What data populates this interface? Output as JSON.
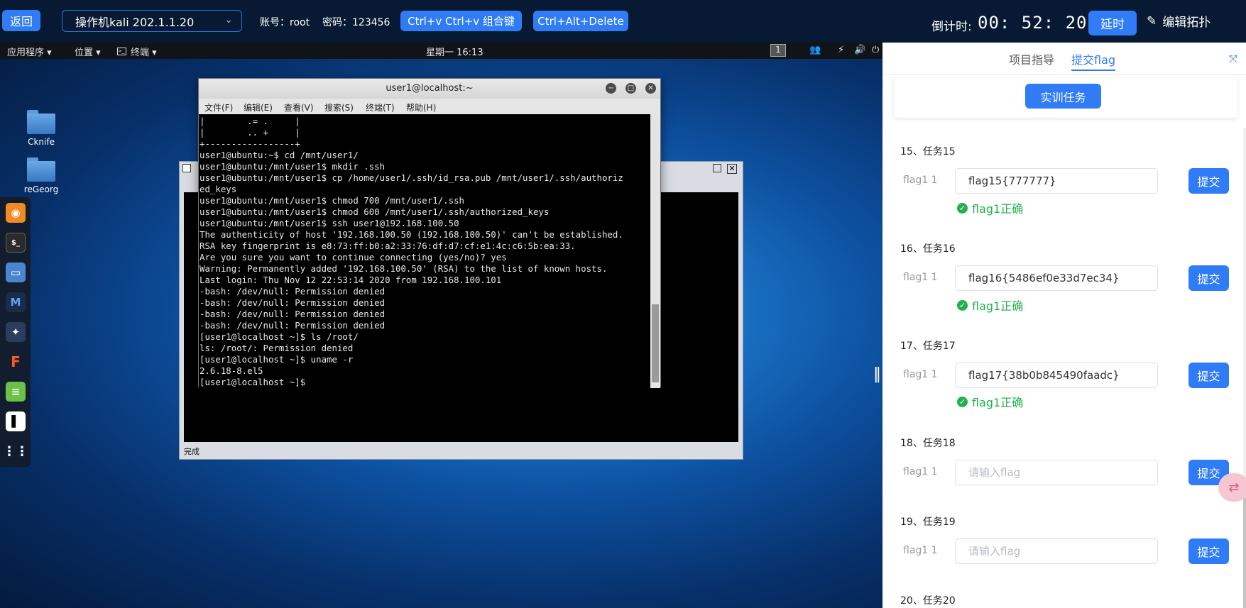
{
  "topbar": {
    "back_label": "返回",
    "host_label": "操作机kali 202.1.1.20",
    "account_label": "账号：root",
    "password_label": "密码：123456",
    "paste_combo_label": "Ctrl+v  Ctrl+v 组合键",
    "cad_label": "Ctrl+Alt+Delete",
    "countdown_label": "倒计时:",
    "countdown_value": "00:  52:  20",
    "extend_label": "延时",
    "edit_topology_label": "编辑拓扑"
  },
  "gnome": {
    "apps_label": "应用程序 ▾",
    "places_label": "位置 ▾",
    "terminal_label": "终端 ▾",
    "clock": "星期一 16:13",
    "workspace": "1"
  },
  "desktop_icons": [
    {
      "label": "Cknife"
    },
    {
      "label": "reGeorg"
    }
  ],
  "back_window": {
    "status": "完成"
  },
  "terminal": {
    "title": "user1@localhost:~",
    "menu": [
      "文件(F)",
      "编辑(E)",
      "查看(V)",
      "搜索(S)",
      "终端(T)",
      "帮助(H)"
    ],
    "lines": [
      "|        .= .     |",
      "|        .. +     |",
      "+-----------------+",
      "user1@ubuntu:~$ cd /mnt/user1/",
      "user1@ubuntu:/mnt/user1$ mkdir .ssh",
      "user1@ubuntu:/mnt/user1$ cp /home/user1/.ssh/id_rsa.pub /mnt/user1/.ssh/authoriz",
      "ed_keys",
      "user1@ubuntu:/mnt/user1$ chmod 700 /mnt/user1/.ssh",
      "user1@ubuntu:/mnt/user1$ chmod 600 /mnt/user1/.ssh/authorized_keys",
      "user1@ubuntu:/mnt/user1$ ssh user1@192.168.100.50",
      "The authenticity of host '192.168.100.50 (192.168.100.50)' can't be established.",
      "RSA key fingerprint is e8:73:ff:b0:a2:33:76:df:d7:cf:e1:4c:c6:5b:ea:33.",
      "Are you sure you want to continue connecting (yes/no)? yes",
      "Warning: Permanently added '192.168.100.50' (RSA) to the list of known hosts.",
      "Last login: Thu Nov 12 22:53:14 2020 from 192.168.100.101",
      "-bash: /dev/null: Permission denied",
      "-bash: /dev/null: Permission denied",
      "-bash: /dev/null: Permission denied",
      "-bash: /dev/null: Permission denied",
      "[user1@localhost ~]$ ls /root/",
      "ls: /root/: Permission denied",
      "[user1@localhost ~]$ uname -r",
      "2.6.18-8.el5",
      "[user1@localhost ~]$"
    ]
  },
  "panel": {
    "tab_guide": "项目指导",
    "tab_flag": "提交flag",
    "task_button": "实训任务",
    "flag_field_label": "flag1 1",
    "placeholder": "请输入flag",
    "submit_label": "提交",
    "tasks": [
      {
        "title": "15、任务15",
        "value": "flag15{777777}",
        "status": "flag1正确"
      },
      {
        "title": "16、任务16",
        "value": "flag16{5486ef0e33d7ec34}",
        "status": "flag1正确"
      },
      {
        "title": "17、任务17",
        "value": "flag17{38b0b845490faadc}",
        "status": "flag1正确"
      },
      {
        "title": "18、任务18",
        "value": "",
        "status": ""
      },
      {
        "title": "19、任务19",
        "value": "",
        "status": ""
      },
      {
        "title": "20、任务20",
        "value": "",
        "status": ""
      }
    ]
  }
}
